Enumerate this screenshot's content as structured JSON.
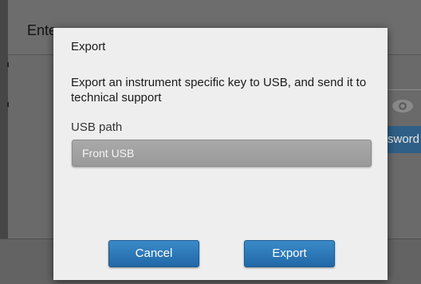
{
  "background": {
    "title": "Ente",
    "password_button_label": "sword",
    "eye_icon": "eye-icon"
  },
  "dialog": {
    "title": "Export",
    "message": "Export an instrument specific key to USB, and send it to technical support",
    "field_label": "USB path",
    "usb_path_value": "Front USB",
    "cancel_label": "Cancel",
    "export_label": "Export"
  },
  "colors": {
    "button_blue": "#2a74b4",
    "dialog_bg": "#eeeeee",
    "select_bg": "#a3a3a3"
  }
}
